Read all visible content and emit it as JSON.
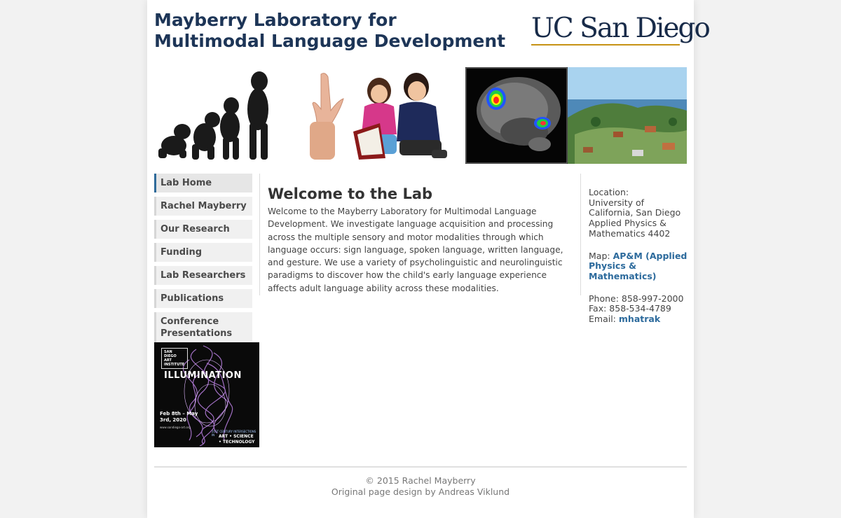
{
  "header": {
    "title_line1": "Mayberry Laboratory for",
    "title_line2": "Multimodal Language Development",
    "logo_text": "UC San Diego"
  },
  "banner": {
    "panels": [
      "evolution-silhouettes",
      "sign-language-hand",
      "children-reading",
      "brain-mri-scan",
      "coastal-campus-view"
    ]
  },
  "nav": {
    "items": [
      {
        "label": "Lab Home",
        "active": true
      },
      {
        "label": "Rachel Mayberry"
      },
      {
        "label": "Our Research"
      },
      {
        "label": "Funding"
      },
      {
        "label": "Lab Researchers"
      },
      {
        "label": "Publications"
      },
      {
        "label": "Conference Presentations"
      }
    ]
  },
  "poster": {
    "org": "SAN DIEGO ART INSTITUTE",
    "title": "ILLUMINATION",
    "dates": "Feb 8th – May 3rd, 2020",
    "url": "www.sandiego-art.org",
    "series": "21ST CENTURY INTERSECTIONS IN",
    "theme": "ART • SCIENCE • TECHNOLOGY"
  },
  "main": {
    "heading": "Welcome to the Lab",
    "body": "Welcome to the Mayberry Laboratory for Multimodal Language Development. We investigate language acquisition and processing across the multiple sensory and motor modalities through which language occurs: sign language, spoken language, written language, and gesture. We use a variety of psycholinguistic and neurolinguistic paradigms to discover how the child's early language experience affects adult language ability across these modalities."
  },
  "info": {
    "location_label": "Location:",
    "location_lines": [
      "University of",
      "California, San Diego",
      "Applied Physics &",
      "Mathematics 4402"
    ],
    "map_label": "Map:",
    "map_link": "AP&M (Applied Physics & Mathematics)",
    "phone": "Phone: 858-997-2000",
    "fax": "Fax: 858-534-4789",
    "email_label": "Email:",
    "email_link": "mhatrak"
  },
  "footer": {
    "copyright": "© 2015 Rachel Mayberry",
    "credit": "Original page design by Andreas Viklund"
  },
  "colors": {
    "title": "#1d3557",
    "link": "#2c6a9c",
    "active_nav_border": "#2f6b9a",
    "ucsd_gold": "#c69214"
  }
}
